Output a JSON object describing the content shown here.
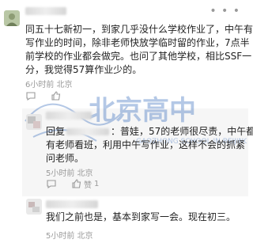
{
  "posts": [
    {
      "lines": [
        "同五十七新初一，到家几乎没什么学校作业了，中午有",
        "写作业的时间，除非老师快放学临时留的作业，7点半",
        "前学校的作业都会做完。也问了其他学校，相比SSF一",
        "分，我觉得57算作业少的。"
      ],
      "meta": "6小时前  北京",
      "icons": [
        "comment-icon",
        "like-icon"
      ]
    },
    {
      "prefix": "回复",
      "lines": [
        "：普娃，57的老师很尽责，中午都",
        "有老师看班，利用中午写作业，这样不会的抓紧",
        "问老师。"
      ],
      "meta": "5小时前  北京",
      "like_label": "赞",
      "like_count": "1"
    },
    {
      "lines": [
        "我们之前也是，基本到家写一会。现在初三。"
      ],
      "meta": "5小时前  北京"
    }
  ],
  "watermark": {
    "cn": "北京高中",
    "en": "GAOZHONG SCHOOL IN BEIJING"
  },
  "colors": {
    "text": "#222222",
    "meta": "#9a9a9a",
    "reply_bg": "#f6f6f6",
    "watermark": "#2a63b8"
  }
}
